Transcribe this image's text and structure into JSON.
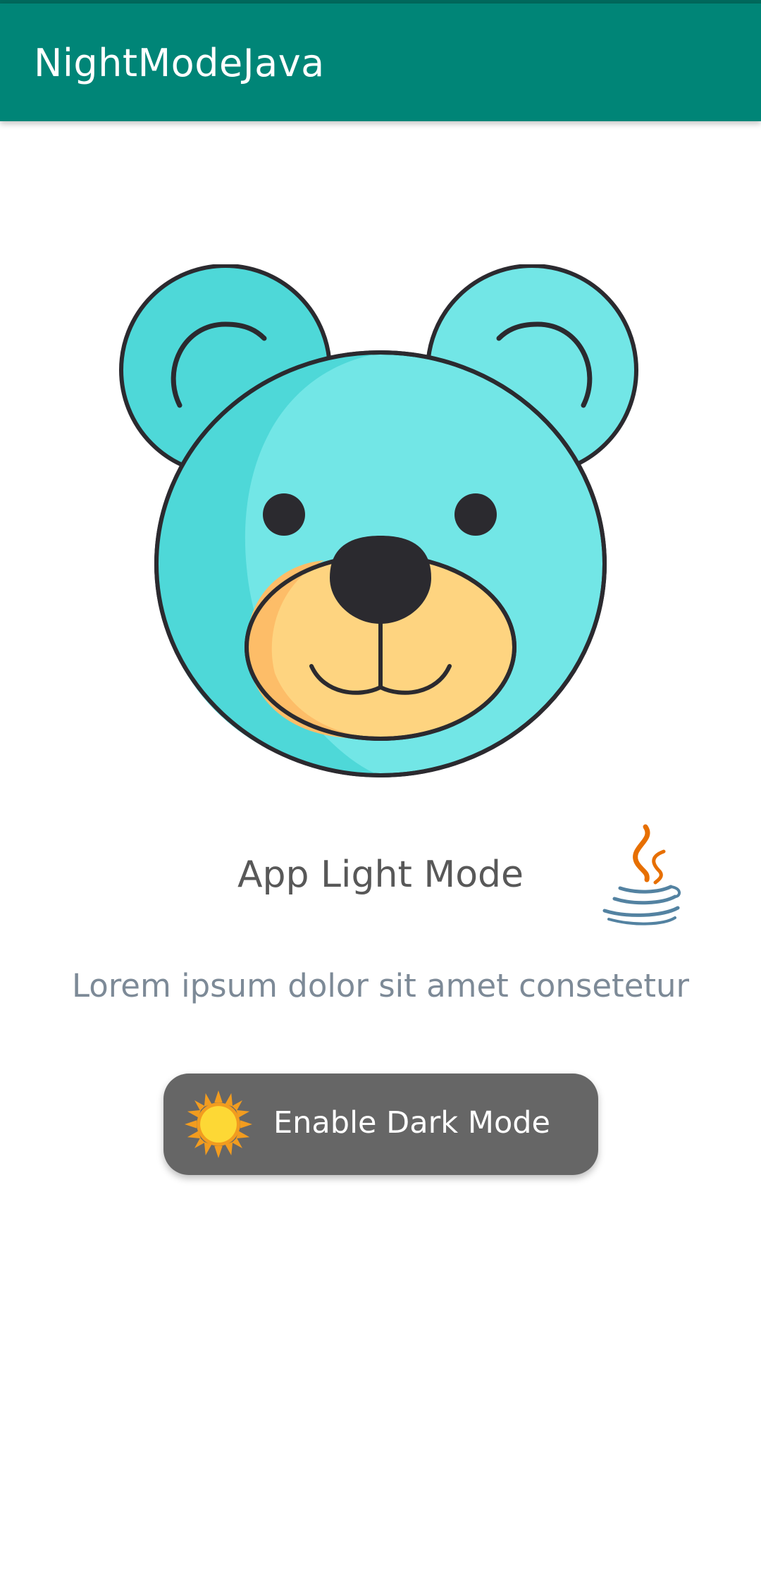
{
  "app": {
    "title": "NightModeJava",
    "colors": {
      "primary": "#008577",
      "primary_dark": "#00695c",
      "button": "#666666"
    }
  },
  "main": {
    "illustration_icon": "teddy-bear-face",
    "mode_title": "App Light Mode",
    "logo_icon": "java-cup-logo",
    "description": "Lorem ipsum dolor sit amet consetetur",
    "toggle_button": {
      "label": "Enable Dark Mode",
      "icon": "sun-icon"
    }
  }
}
